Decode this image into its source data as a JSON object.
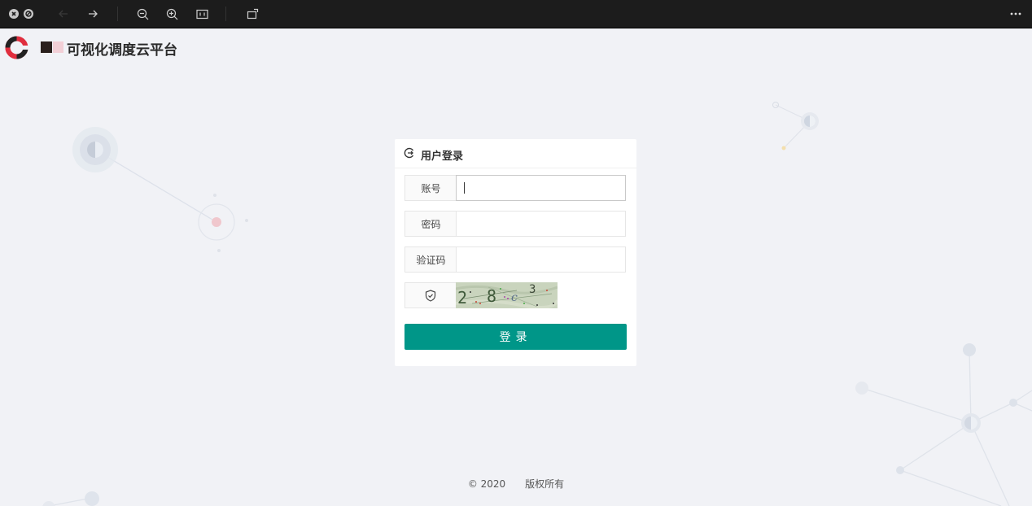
{
  "toolbar": {
    "icons": [
      "close-circle-icon",
      "block-icon",
      "arrow-left-icon",
      "arrow-right-icon",
      "zoom-out-icon",
      "zoom-in-icon",
      "fit-icon",
      "rotate-icon",
      "more-icon"
    ]
  },
  "brand": {
    "title": "可视化调度云平台"
  },
  "login": {
    "title": "用户登录",
    "account_label": "账号",
    "account_value": "",
    "password_label": "密码",
    "password_value": "",
    "captcha_label": "验证码",
    "captcha_value": "",
    "captcha_text": "2 8 c 3",
    "submit_label": "登录"
  },
  "footer": {
    "copyright": "© 2020",
    "rights": "版权所有"
  },
  "colors": {
    "primary": "#009688",
    "toolbar_bg": "#1c1c1c",
    "page_bg": "#f1f2f6"
  }
}
